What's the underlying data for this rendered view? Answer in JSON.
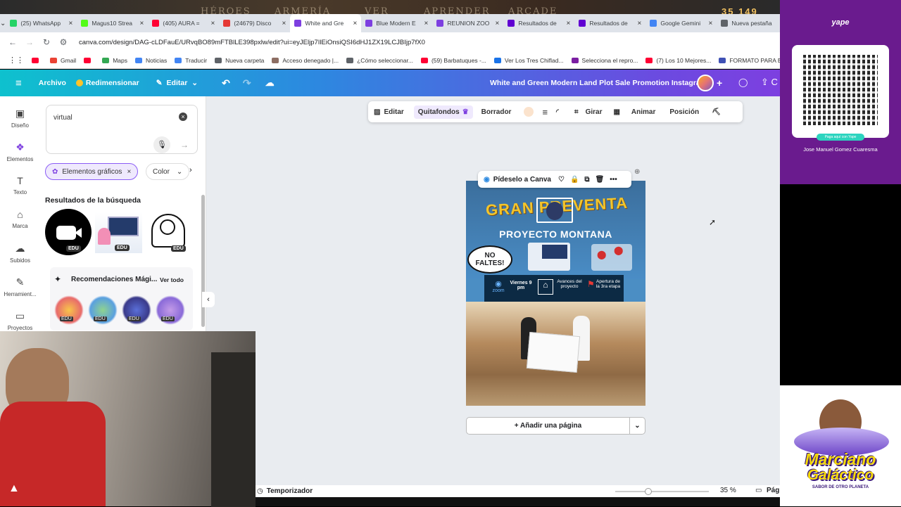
{
  "background_game": {
    "menu": [
      "HÉROES",
      "ARMERÍA",
      "VER",
      "APRENDER",
      "ARCADE"
    ],
    "counter": "35 149"
  },
  "tabs": [
    {
      "label": "(25) WhatsApp",
      "color": "#25d366"
    },
    {
      "label": "Magus10 Strea",
      "color": "#53fc18"
    },
    {
      "label": "(405) AURA =",
      "color": "#ff0033"
    },
    {
      "label": "(24679) Disco",
      "color": "#e53935"
    },
    {
      "label": "White and Gre",
      "color": "#7d3fe0"
    },
    {
      "label": "Blue Modern E",
      "color": "#7d3fe0"
    },
    {
      "label": "REUNION ZOO",
      "color": "#7d3fe0"
    },
    {
      "label": "Resultados de",
      "color": "#6001d2"
    },
    {
      "label": "Resultados de",
      "color": "#6001d2"
    },
    {
      "label": "Google Gemini",
      "color": "#4285f4"
    },
    {
      "label": "Nueva pestaña",
      "color": "#5f6368"
    }
  ],
  "url": "canva.com/design/DAG-cLDFauE/URvqBO89mFTBlLE398pxlw/edit?ui=eyJEljp7IlEiOnsiQSI6dHJ1ZX19LCJBIjp7fX0",
  "bookmarks": [
    {
      "label": "",
      "color": "#ff0033"
    },
    {
      "label": "Gmail",
      "color": "#ea4335"
    },
    {
      "label": "",
      "color": "#ff0033"
    },
    {
      "label": "Maps",
      "color": "#34a853"
    },
    {
      "label": "Noticias",
      "color": "#4285f4"
    },
    {
      "label": "Traducir",
      "color": "#4285f4"
    },
    {
      "label": "Nueva carpeta",
      "color": "#5f6368"
    },
    {
      "label": "Acceso denegado |...",
      "color": "#8d6e63"
    },
    {
      "label": "¿Cómo seleccionar...",
      "color": "#5f6368"
    },
    {
      "label": "(59) Barbatuques -...",
      "color": "#ff0033"
    },
    {
      "label": "Ver Los Tres Chiflad...",
      "color": "#1a73e8"
    },
    {
      "label": "Selecciona el repro...",
      "color": "#7b1fa2"
    },
    {
      "label": "(7) Los 10 Mejores...",
      "color": "#ff0033"
    },
    {
      "label": "FORMATO PARA EL...",
      "color": "#3f51b5"
    }
  ],
  "header": {
    "archivo": "Archivo",
    "redimensionar": "Redimensionar",
    "editar": "Editar",
    "doc_title": "White and Green Modern Land Plot Sale Promotion Instagra..."
  },
  "rail": [
    {
      "label": "Diseño",
      "icon": "layout-icon"
    },
    {
      "label": "Elementos",
      "icon": "elements-icon"
    },
    {
      "label": "Texto",
      "icon": "text-icon"
    },
    {
      "label": "Marca",
      "icon": "brand-icon"
    },
    {
      "label": "Subidos",
      "icon": "upload-icon"
    },
    {
      "label": "Herramient...",
      "icon": "tools-icon"
    },
    {
      "label": "Proyectos",
      "icon": "folder-icon"
    }
  ],
  "panel": {
    "search_value": "virtual",
    "chip_graphics": "Elementos gráficos",
    "chip_color": "Color",
    "results_title": "Resultados de la búsqueda",
    "edu": "EDU",
    "magic_title": "Recomendaciones Mági...",
    "see_all": "Ver todo"
  },
  "ctxbar": {
    "editar": "Editar",
    "quitafondos": "Quitafondos",
    "borrador": "Borrador",
    "girar": "Girar",
    "animar": "Animar",
    "posicion": "Posición"
  },
  "design": {
    "ask_canva": "Pídeselo a Canva",
    "title": "GRAN PREVENTA",
    "subtitle": "PROYECTO MONTANA",
    "no_faltes": "NO FALTES!",
    "zoom": "zoom",
    "viernes": "Viernes 9 pm",
    "avances": "Avances del proyecto",
    "apertura": "Apertura de la 3ra etapa"
  },
  "add_page": "+ Añadir una página",
  "footer": {
    "timer": "Temporizador",
    "zoom": "35 %",
    "zoom_level": 0.35,
    "pages": "Pági"
  },
  "yape": {
    "logo": "yape",
    "caption": "Paga aquí con Yape",
    "name": "Jose Manuel Gomez Cuaresma"
  },
  "marciano": {
    "line1": "Marciano",
    "line2": "Galáctico",
    "tagline": "SABOR DE OTRO PLANETA"
  }
}
